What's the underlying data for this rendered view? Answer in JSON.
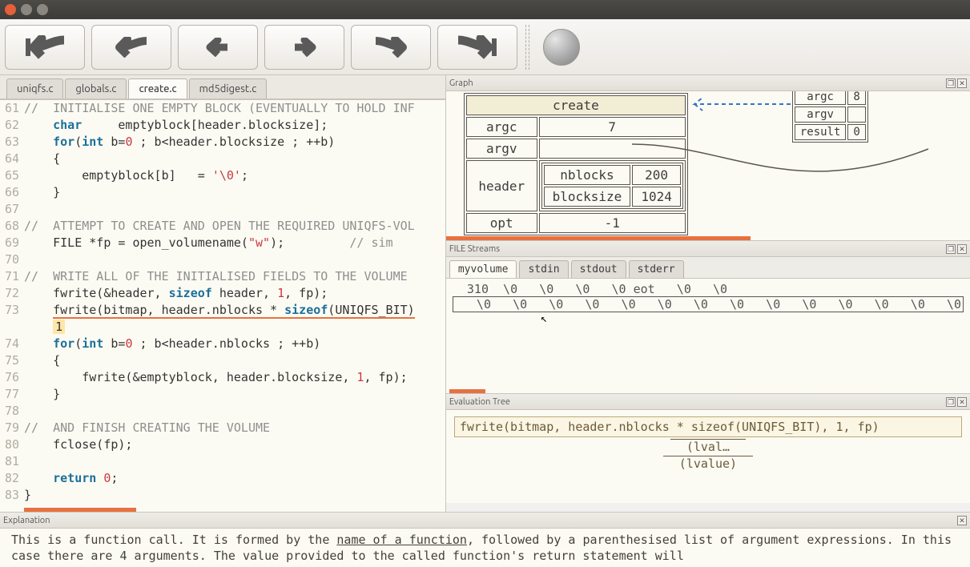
{
  "window": {
    "title": ""
  },
  "code_tabs": [
    "uniqfs.c",
    "globals.c",
    "create.c",
    "md5digest.c"
  ],
  "active_code_tab": "create.c",
  "code_lines": [
    {
      "n": 61,
      "t": "//  INITIALISE ONE EMPTY BLOCK (EVENTUALLY TO HOLD INF",
      "cls": "cm"
    },
    {
      "n": 62,
      "t": "    char     emptyblock[header.blocksize];",
      "kw": [
        "char"
      ]
    },
    {
      "n": 63,
      "t": "    for(int b=0 ; b<header.blocksize ; ++b)",
      "kw": [
        "for",
        "int"
      ],
      "num": [
        "0"
      ]
    },
    {
      "n": 64,
      "t": "    {"
    },
    {
      "n": 65,
      "t": "        emptyblock[b]   = '\\0';",
      "str": [
        "'\\0'"
      ]
    },
    {
      "n": 66,
      "t": "    }"
    },
    {
      "n": 67,
      "t": ""
    },
    {
      "n": 68,
      "t": "//  ATTEMPT TO CREATE AND OPEN THE REQUIRED UNIQFS-VOL",
      "cls": "cm"
    },
    {
      "n": 69,
      "t": "    FILE *fp = open_volumename(\"w\");         // sim",
      "str": [
        "\"w\""
      ],
      "cm_tail": "// sim"
    },
    {
      "n": 70,
      "t": ""
    },
    {
      "n": 71,
      "t": "//  WRITE ALL OF THE INITIALISED FIELDS TO THE VOLUME",
      "cls": "cm"
    },
    {
      "n": 72,
      "t": "    fwrite(&header, sizeof header, 1, fp);",
      "kw": [
        "sizeof"
      ],
      "num": [
        "1"
      ]
    },
    {
      "n": 73,
      "t": "    fwrite(bitmap, header.nblocks * sizeof(UNIQFS_BIT)",
      "kw": [
        "sizeof"
      ],
      "hl": true,
      "indent_hl": "1"
    },
    {
      "n": 74,
      "t": "    for(int b=0 ; b<header.nblocks ; ++b)",
      "kw": [
        "for",
        "int"
      ],
      "num": [
        "0"
      ]
    },
    {
      "n": 75,
      "t": "    {"
    },
    {
      "n": 76,
      "t": "        fwrite(&emptyblock, header.blocksize, 1, fp);",
      "num": [
        "1"
      ]
    },
    {
      "n": 77,
      "t": "    }"
    },
    {
      "n": 78,
      "t": ""
    },
    {
      "n": 79,
      "t": "//  AND FINISH CREATING THE VOLUME",
      "cls": "cm"
    },
    {
      "n": 80,
      "t": "    fclose(fp);"
    },
    {
      "n": 81,
      "t": ""
    },
    {
      "n": 82,
      "t": "    return 0;",
      "kw": [
        "return"
      ],
      "num": [
        "0"
      ]
    },
    {
      "n": 83,
      "t": "}"
    }
  ],
  "graph": {
    "title": "Graph",
    "left_table": {
      "name": "create",
      "rows": [
        {
          "k": "argc",
          "v": "7"
        },
        {
          "k": "argv",
          "v": ""
        },
        {
          "k": "header",
          "sub": [
            {
              "k": "nblocks",
              "v": "200"
            },
            {
              "k": "blocksize",
              "v": "1024"
            }
          ]
        },
        {
          "k": "opt",
          "v": "-1"
        }
      ]
    },
    "right_table": [
      {
        "k": "argc",
        "v": "8"
      },
      {
        "k": "argv",
        "v": ""
      },
      {
        "k": "result",
        "v": "0"
      }
    ]
  },
  "streams": {
    "title": "FILE Streams",
    "tabs": [
      "myvolume",
      "stdin",
      "stdout",
      "stderr"
    ],
    "active": "myvolume",
    "row1": "  310  \\0   \\0   \\0   \\0 eot   \\0   \\0",
    "row2": "   \\0   \\0   \\0   \\0   \\0   \\0   \\0   \\0   \\0   \\0   \\0   \\0   \\0   \\0"
  },
  "eval": {
    "title": "Evaluation Tree",
    "line": "fwrite(bitmap, header.nblocks * sizeof(UNIQFS_BIT), 1, fp)",
    "sub1": "(lval…",
    "sub2": "(lvalue)"
  },
  "explain": {
    "title": "Explanation",
    "text_pre": "This is a function call. It is formed by the ",
    "text_link": "name of a function",
    "text_post": ", followed by a parenthesised list of argument expressions. In this case there are 4 arguments. The value provided to the called function's return statement will"
  }
}
